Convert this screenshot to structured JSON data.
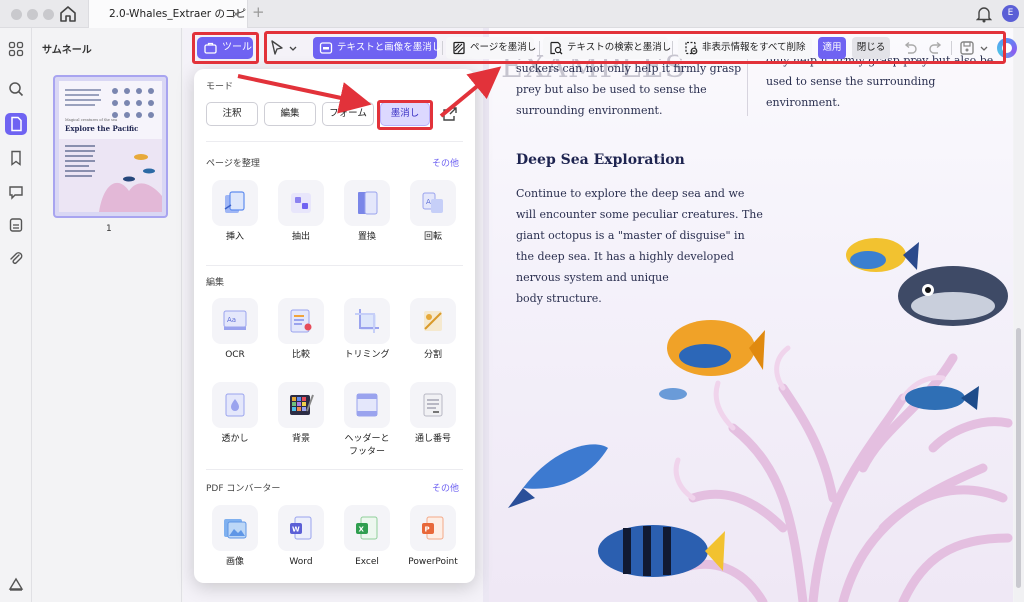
{
  "titlebar": {
    "tab_title": "2.0-Whales_Extraer のコピー",
    "tab_close": "×",
    "tab_add": "+",
    "user_initial": "E"
  },
  "sidebar": {
    "panel_title": "サムネール",
    "page_number": "1",
    "thumbnail": {
      "kicker": "Magical creatures of the sea",
      "title": "Explore the Pacific"
    }
  },
  "toolbar": {
    "tools_label": "ツール",
    "redact_text_image": "テキストと画像を墨消し",
    "redact_pages": "ページを墨消し",
    "search_redact": "テキストの検索と墨消し",
    "remove_hidden": "非表示情報をすべて削除",
    "apply": "適用",
    "close": "閉じる"
  },
  "panel": {
    "mode_label": "モード",
    "modes": [
      "注釈",
      "編集",
      "フォーム",
      "墨消し"
    ],
    "active_mode": "墨消し",
    "organize_label": "ページを整理",
    "organize_more": "その他",
    "organize_items": [
      "挿入",
      "抽出",
      "置換",
      "回転"
    ],
    "edit_label": "編集",
    "edit_items": [
      "OCR",
      "比較",
      "トリミング",
      "分割"
    ],
    "edit_items_2": [
      "透かし",
      "背景",
      "ヘッダーと\nフッター",
      "通し番号"
    ],
    "converter_label": "PDF コンバーター",
    "converter_more": "その他",
    "converter_items": [
      "画像",
      "Word",
      "Excel",
      "PowerPoint"
    ]
  },
  "document": {
    "ghost_title": "EXAMPLES",
    "left_column": [
      "suckers can not only help it firmly grasp",
      "prey but also be used to sense the",
      "surrounding environment."
    ],
    "right_column": [
      "only help it firmly grasp prey but also be",
      "used to sense the surrounding",
      "environment."
    ],
    "heading": "Deep Sea Exploration",
    "body": [
      "Continue to explore the deep sea and we",
      "will encounter some peculiar creatures. The",
      "giant octopus is a \"master of disguise\" in",
      "the deep sea. It has a highly developed",
      "nervous system and unique",
      "body structure."
    ]
  },
  "colors": {
    "accent": "#6f63f2",
    "highlight": "#e2323a"
  }
}
